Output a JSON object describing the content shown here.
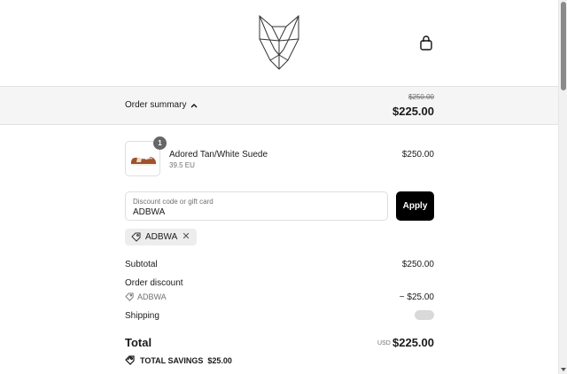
{
  "header": {
    "logo_icon": "geometric-wolf-head-logo",
    "cart_icon": "shopping-bag-icon"
  },
  "summary": {
    "toggle_label": "Order summary",
    "toggle_icon": "chevron-up-icon",
    "original_price": "$250.00",
    "discounted_price": "$225.00"
  },
  "product": {
    "quantity": "1",
    "name": "Adored Tan/White Suede",
    "variant": "39.5 EU",
    "price": "$250.00"
  },
  "discount": {
    "placeholder": "Discount code or gift card",
    "value": "ADBWA",
    "apply_label": "Apply"
  },
  "applied_code": {
    "code": "ADBWA",
    "remove_icon": "close-icon",
    "tag_icon": "tag-icon"
  },
  "costs": {
    "subtotal_label": "Subtotal",
    "subtotal_value": "$250.00",
    "discount_label": "Order discount",
    "discount_code": "ADBWA",
    "discount_value": "− $25.00",
    "shipping_label": "Shipping"
  },
  "total": {
    "label": "Total",
    "currency": "USD",
    "amount": "$225.00",
    "savings_label": "TOTAL SAVINGS",
    "savings_amount": "$25.00"
  }
}
